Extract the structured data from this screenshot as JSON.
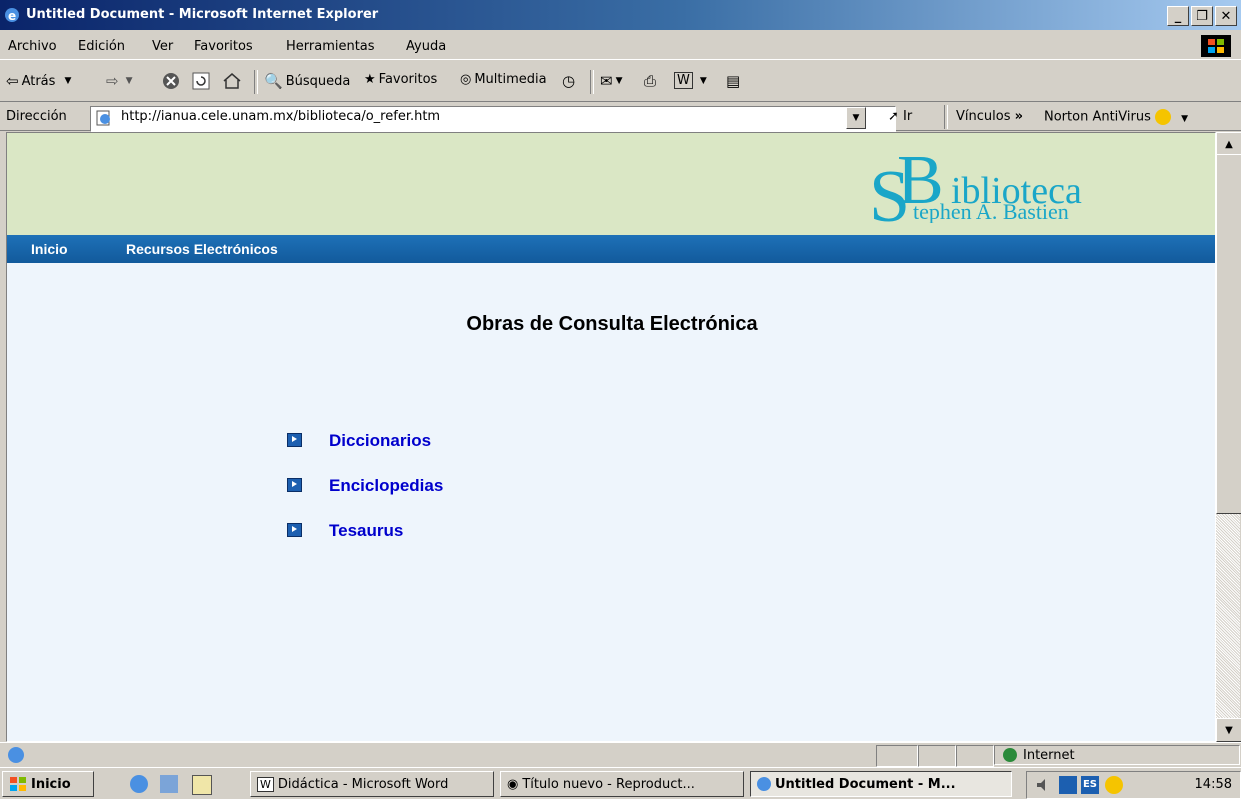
{
  "window": {
    "title": "Untitled Document - Microsoft Internet Explorer"
  },
  "menu": [
    "Archivo",
    "Edición",
    "Ver",
    "Favoritos",
    "Herramientas",
    "Ayuda"
  ],
  "toolbar": {
    "back": "Atrás",
    "search": "Búsqueda",
    "favorites": "Favoritos",
    "media": "Multimedia"
  },
  "address": {
    "label": "Dirección",
    "url": "http://ianua.cele.unam.mx/biblioteca/o_refer.htm",
    "go": "Ir",
    "links": "Vínculos",
    "links_chevron": "»",
    "norton": "Norton AntiVirus"
  },
  "page": {
    "logo": {
      "big_letters": "SB",
      "word1": "iblioteca",
      "word2": "tephen A. Bastien"
    },
    "nav": [
      "Inicio",
      "Recursos Electrónicos"
    ],
    "title": "Obras de Consulta Electrónica",
    "links": [
      "Diccionarios",
      "Enciclopedias",
      "Tesaurus"
    ]
  },
  "status": {
    "zone": "Internet"
  },
  "taskbar": {
    "start": "Inicio",
    "tasks": [
      {
        "label": "Didáctica - Microsoft Word",
        "active": false
      },
      {
        "label": "Título nuevo - Reproduct...",
        "active": false
      },
      {
        "label": "Untitled Document - M...",
        "active": true
      }
    ],
    "tray_lang": "ES",
    "clock": "14:58"
  },
  "colors": {
    "titlebar": "#0a246a",
    "banner": "#dae7c5",
    "navbar": "#1a69b0",
    "page_bg": "#eef5fc",
    "link": "#0000cc",
    "logo_teal": "#1aa6c8"
  }
}
